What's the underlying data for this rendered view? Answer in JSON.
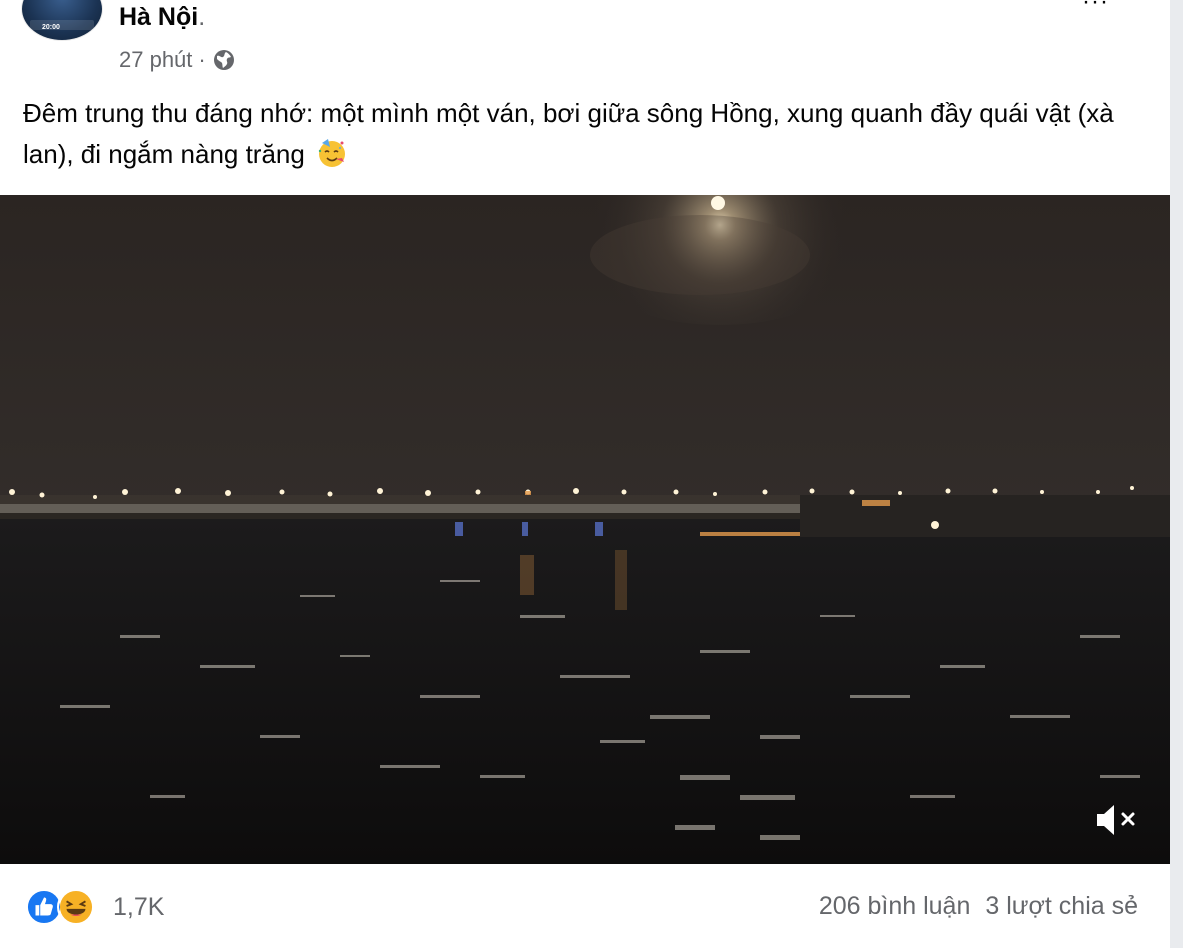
{
  "post": {
    "author_suffix": "Hà Nội",
    "author_punct": ".",
    "timestamp": "27 phút",
    "separator": "·",
    "audience_icon": "globe-icon",
    "text": "Đêm trung thu đáng nhớ: một mình một ván, bơi giữa sông Hồng, xung quanh đầy quái vật (xà lan), đi ngắm nàng trăng",
    "text_emoji": "partying-face-emoji"
  },
  "avatar": {
    "badge_text": "20:00"
  },
  "video": {
    "mute_icon": "speaker-muted-icon",
    "mute_symbol": "×"
  },
  "footer": {
    "reaction_icons": [
      "like-icon",
      "haha-icon"
    ],
    "reaction_count": "1,7K",
    "comments": "206 bình luận",
    "shares": "3 lượt chia sẻ"
  },
  "colors": {
    "secondary_text": "#65676b",
    "primary_text": "#050505",
    "like_blue": "#1877f2",
    "haha_yellow": "#f7b125"
  }
}
